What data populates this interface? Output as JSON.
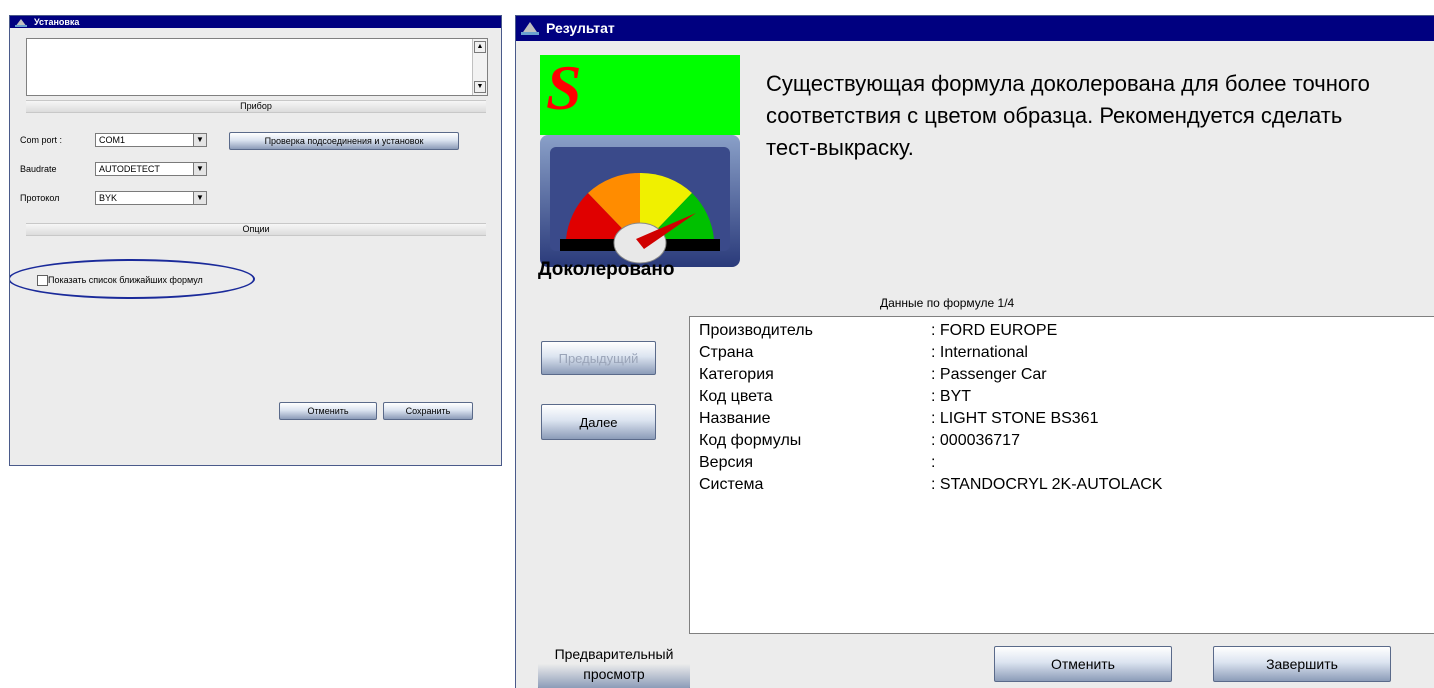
{
  "setup": {
    "title": "Установка",
    "section_device": "Прибор",
    "com_port_label": "Com port :",
    "com_port_value": "COM1",
    "baudrate_label": "Baudrate",
    "baudrate_value": "AUTODETECT",
    "protocol_label": "Протокол",
    "protocol_value": "BYK",
    "check_button": "Проверка подсоединения и установок",
    "section_options": "Опции",
    "checkbox_label": "Показать список ближайших формул",
    "checkbox_checked": false,
    "cancel_button": "Отменить",
    "save_button": "Сохранить",
    "highlight_color": "#1a2a9a"
  },
  "result": {
    "title": "Результат",
    "badge_letter": "S",
    "message": "Существующая формула доколерована для более точного соответствия с цветом образца. Рекомендуется сделать тест-выкраску.",
    "status": "Доколеровано",
    "formula_header": "Данные по формуле 1/4",
    "prev_button": "Предыдущий",
    "next_button": "Далее",
    "details": [
      {
        "key": "Производитель",
        "value": ": FORD EUROPE"
      },
      {
        "key": "Страна",
        "value": ": International"
      },
      {
        "key": "Категория",
        "value": ": Passenger Car"
      },
      {
        "key": "Код цвета",
        "value": ": BYT"
      },
      {
        "key": "Название",
        "value": ": LIGHT STONE BS361"
      },
      {
        "key": "Код формулы",
        "value": ": 000036717"
      },
      {
        "key": "Версия",
        "value": ":"
      },
      {
        "key": "Система",
        "value": ": STANDOCRYL 2K-AUTOLACK"
      }
    ],
    "preview_button": "Предварительный просмотр",
    "cancel_button": "Отменить",
    "finish_button": "Завершить",
    "badge_bg_color": "#00ff00",
    "badge_letter_color": "#ff0000"
  }
}
